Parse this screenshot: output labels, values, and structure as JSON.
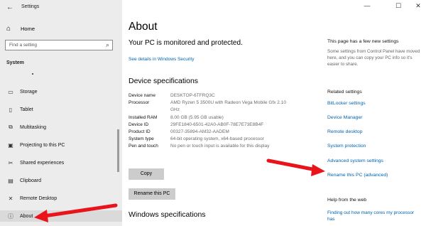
{
  "window": {
    "title": "Settings",
    "minimize": "—",
    "maximize": "☐",
    "close": "✕"
  },
  "sidebar": {
    "home": "Home",
    "search_placeholder": "Find a setting",
    "section": "System",
    "items": [
      {
        "label": "Storage",
        "icon": "storage-icon",
        "glyph": "▭"
      },
      {
        "label": "Tablet",
        "icon": "tablet-icon",
        "glyph": "▯"
      },
      {
        "label": "Multitasking",
        "icon": "multitasking-icon",
        "glyph": "⧉"
      },
      {
        "label": "Projecting to this PC",
        "icon": "projecting-icon",
        "glyph": "▣"
      },
      {
        "label": "Shared experiences",
        "icon": "shared-experiences-icon",
        "glyph": "✂"
      },
      {
        "label": "Clipboard",
        "icon": "clipboard-icon",
        "glyph": "▤"
      },
      {
        "label": "Remote Desktop",
        "icon": "remote-desktop-icon",
        "glyph": "✕"
      },
      {
        "label": "About",
        "icon": "info-icon",
        "glyph": "ⓘ"
      }
    ]
  },
  "main": {
    "title": "About",
    "protection_status": "Your PC is monitored and protected.",
    "security_link": "See details in Windows Security",
    "device_specs_heading": "Device specifications",
    "specs": [
      {
        "k": "Device name",
        "v": "DESKTOP-6TFRQ3C"
      },
      {
        "k": "Processor",
        "v": "AMD Ryzen 5 3500U with Radeon Vega Mobile Gfx 2.10 GHz"
      },
      {
        "k": "Installed RAM",
        "v": "8.00 GB (5.95 GB usable)"
      },
      {
        "k": "Device ID",
        "v": "29FE1840-6501-42A0-AB0F-78E7E73E8B4F"
      },
      {
        "k": "Product ID",
        "v": "00327-35894-AM32-AADEM"
      },
      {
        "k": "System type",
        "v": "64-bit operating system, x64-based processor"
      },
      {
        "k": "Pen and touch",
        "v": "No pen or touch input is available for this display"
      }
    ],
    "copy_button": "Copy",
    "rename_button": "Rename this PC",
    "windows_specs_heading": "Windows specifications"
  },
  "right": {
    "note_title": "This page has a few new settings",
    "note_body": "Some settings from Control Panel have moved here, and you can copy your PC info so it's easier to share.",
    "related_heading": "Related settings",
    "related_links": [
      "BitLocker settings",
      "Device Manager",
      "Remote desktop",
      "System protection",
      "Advanced system settings",
      "Rename this PC (advanced)"
    ],
    "help_heading": "Help from the web",
    "help_link": "Finding out how many cores my processor has"
  },
  "colors": {
    "accent_link": "#0063b1",
    "arrow": "#e8131b",
    "sidebar_bg": "#ececec"
  }
}
